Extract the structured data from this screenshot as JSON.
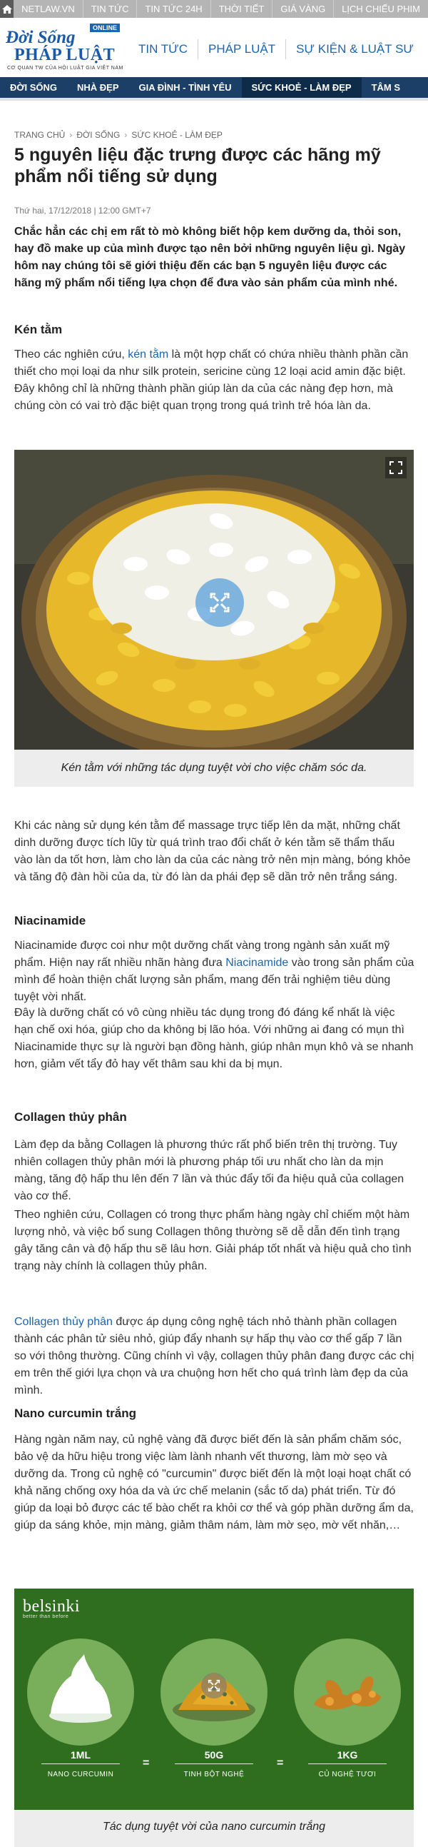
{
  "topbar": {
    "home_icon": "home-icon",
    "links": [
      "NETLAW.VN",
      "TIN TỨC",
      "TIN TỨC 24H",
      "THỜI TIẾT",
      "GIÁ VÀNG",
      "LỊCH CHIẾU PHIM"
    ]
  },
  "logo": {
    "online": "ONLINE",
    "line1": "Đời Sống",
    "line2": "PHÁP LUẬT",
    "tagline": "CƠ QUAN TW CỦA HỘI LUẬT GIA VIỆT NAM"
  },
  "mainnav": [
    "TIN TỨC",
    "PHÁP LUẬT",
    "SỰ KIỆN & LUẬT SƯ"
  ],
  "catnav": [
    "ĐỜI SỐNG",
    "NHÀ ĐẸP",
    "GIA ĐÌNH - TÌNH YÊU",
    "SỨC KHOẺ - LÀM ĐẸP",
    "TÂM S"
  ],
  "breadcrumb": [
    "TRANG CHỦ",
    "ĐỜI SỐNG",
    "SỨC KHOẺ - LÀM ĐẸP"
  ],
  "article": {
    "title": "5 nguyên liệu đặc trưng được các hãng mỹ phẩm nổi tiếng sử dụng",
    "date": "Thứ hai, 17/12/2018 | 12:00 GMT+7",
    "sapo": "Chắc hẳn các chị em rất tò mò không biết hộp kem dưỡng da, thỏi son, hay đồ make up của mình được tạo nên bởi những nguyên liệu gì. Ngày hôm nay chúng tôi sẽ giới thiệu đến các bạn 5 nguyên liệu được các hãng mỹ phẩm nổi tiếng lựa chọn để đưa vào sản phẩm của mình nhé.",
    "h_kentam": "Kén tằm",
    "p1_a": "Theo các nghiên cứu, ",
    "p1_link": "kén tằm",
    "p1_b": " là một hợp chất có chứa nhiều thành phần cần thiết cho mọi loại da như silk protein, sericine cùng 12 loại acid amin đặc biệt. Đây không chỉ là những thành phần giúp làn da của các nàng đẹp hơn, mà chúng còn có vai trò đặc biệt quan trọng trong quá trình trẻ hóa làn da.",
    "fig1_caption": "Kén tằm với những tác dụng tuyệt vời cho việc chăm sóc da.",
    "p2": "Khi các nàng sử dụng kén tằm để massage trực tiếp lên da mặt, những chất dinh dưỡng được tích lũy từ quá trình trao đổi chất ở kén tằm sẽ thẩm thấu vào làn da tốt hơn, làm cho làn da của các nàng trở nên mịn màng, bóng khỏe và tăng độ đàn hồi của da, từ đó làn da phái đẹp sẽ dần trở nên trắng sáng.",
    "h_niacinamide": "Niacinamide",
    "p3_a": "Niacinamide được coi như một dưỡng chất vàng trong ngành sản xuất mỹ phẩm. Hiện nay rất nhiều nhãn hàng đưa ",
    "p3_link": "Niacinamide",
    "p3_b": " vào trong sản phẩm của mình để hoàn thiện chất lượng sản phẩm, mang đến trải nghiệm tiêu dùng tuyệt vời nhất.",
    "p4": "Đây là dưỡng chất có vô cùng nhiều tác dụng trong đó đáng kể nhất là việc hạn chế oxi hóa, giúp cho da không bị lão hóa. Với những ai đang có mụn thì Niacinamide thực sự là người bạn đồng hành, giúp nhân mụn khô và se nhanh hơn, giảm vết tẩy đỏ hay vết thâm sau khi da bị mụn.",
    "h_collagen": "Collagen thủy phân",
    "p5": "Làm đẹp da bằng Collagen là phương thức rất phổ biến trên thị trường. Tuy nhiên collagen thủy phân mới là phương pháp tối ưu nhất cho làn da mịn màng, tăng độ hấp thu lên đến 7 lần và thúc đẩy tối đa hiệu quả của collagen vào cơ thể.",
    "p6": "Theo nghiên cứu, Collagen có trong thực phẩm hàng ngày chỉ chiếm một hàm lượng nhỏ, và việc bổ sung Collagen thông thường sẽ dễ dẫn đến tình trạng gây tăng cân và độ hấp thu sẽ lâu hơn. Giải pháp tốt nhất và hiệu quả cho tình trạng này chính là collagen thủy phân.",
    "p7_link": "Collagen thủy phân",
    "p7_b": " được áp dụng công nghệ tách nhỏ thành phần collagen thành các phân tử siêu nhỏ, giúp đẩy nhanh sự hấp thụ vào cơ thể gấp 7 lần so với thông thường. Cũng chính vì vậy, collagen thủy phân đang được các chị em trên thế giới lựa chọn và ưa chuộng hơn hết cho quá trình làm đẹp da của mình.",
    "h_nano": "Nano curcumin trắng",
    "p8": "Hàng ngàn năm nay, củ nghệ vàng đã được biết đến là sản phẩm chăm sóc, bảo vệ da hữu hiệu trong việc làm lành nhanh vết thương, làm mờ sẹo và dưỡng da. Trong củ nghệ có \"curcumin\" được biết đến là một loại hoạt chất có khả năng chống oxy hóa da và ức chế melanin (sắc tố da) phát triển. Từ đó giúp da loại bỏ được các tế bào chết ra khỏi cơ thể và góp phần dưỡng ẩm da, giúp da sáng khỏe, mịn màng, giảm thâm nám, làm mờ sẹo, mờ vết nhăn,…",
    "fig2_caption": "Tác dụng tuyệt vời của nano curcumin trắng"
  },
  "infographic": {
    "brand": "belsinki",
    "brand_tag": "better than before",
    "items": [
      {
        "value": "1ML",
        "unit": "NANO CURCUMIN"
      },
      {
        "value": "50G",
        "unit": "TINH BỘT NGHỆ"
      },
      {
        "value": "1KG",
        "unit": "CỦ NGHỆ TƯƠI"
      }
    ],
    "equals": "="
  },
  "colors": {
    "topbar": "#b5b5b5",
    "brand_blue": "#1a66b0",
    "catbar": "#1b3f66",
    "infographic_bg": "#2f6e1f"
  }
}
